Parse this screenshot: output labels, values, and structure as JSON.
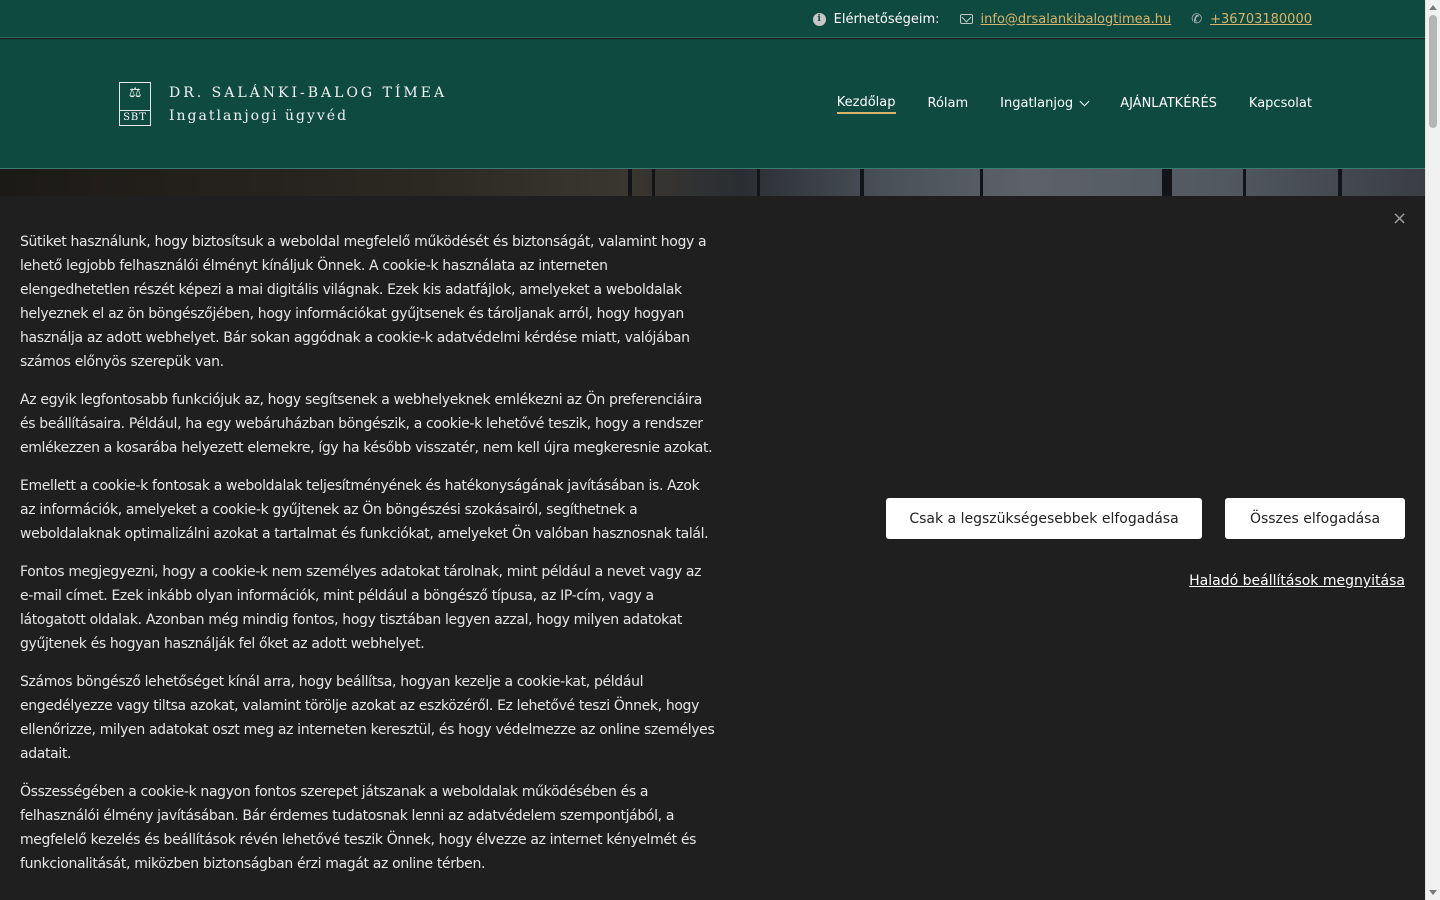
{
  "topbar": {
    "contact_label": "Elérhetőségeim:",
    "email": "info@drsalankibalogtimea.hu",
    "phone": "+36703180000",
    "icons": [
      "info-icon",
      "mail-icon",
      "phone-icon"
    ]
  },
  "header": {
    "logo": {
      "monogram": "SBT",
      "name": "DR. SALÁNKI-BALOG TÍMEA",
      "subtitle": "Ingatlanjogi ügyvéd"
    },
    "nav": [
      {
        "label": "Kezdőlap",
        "active": true
      },
      {
        "label": "Rólam",
        "active": false
      },
      {
        "label": "Ingatlanjog",
        "active": false,
        "has_dropdown": true
      },
      {
        "label": "AJÁNLATKÉRÉS",
        "active": false
      },
      {
        "label": "Kapcsolat",
        "active": false
      }
    ]
  },
  "cookie_banner": {
    "paragraphs": [
      "Sütiket használunk, hogy biztosítsuk a weboldal megfelelő működését és biztonságát, valamint hogy a lehető legjobb felhasználói élményt kínáljuk Önnek. A cookie-k használata az interneten elengedhetetlen részét képezi a mai digitális világnak. Ezek kis adatfájlok, amelyeket a weboldalak helyeznek el az ön böngészőjében, hogy információkat gyűjtsenek és tároljanak arról, hogy hogyan használja az adott webhelyet. Bár sokan aggódnak a cookie-k adatvédelmi kérdése miatt, valójában számos előnyös szerepük van.",
      "Az egyik legfontosabb funkciójuk az, hogy segítsenek a webhelyeknek emlékezni az Ön preferenciáira és beállításaira. Például, ha egy webáruházban böngészik, a cookie-k lehetővé teszik, hogy a rendszer emlékezzen a kosarába helyezett elemekre, így ha később visszatér, nem kell újra megkeresnie azokat.",
      "Emellett a cookie-k fontosak a weboldalak teljesítményének és hatékonyságának javításában is. Azok az információk, amelyeket a cookie-k gyűjtenek az Ön böngészési szokásairól, segíthetnek a weboldalaknak optimalizálni azokat a tartalmat és funkciókat, amelyeket Ön valóban hasznosnak talál.",
      "Fontos megjegyezni, hogy a cookie-k nem személyes adatokat tárolnak, mint például a nevet vagy az e-mail címet. Ezek inkább olyan információk, mint például a böngésző típusa, az IP-cím, vagy a látogatott oldalak. Azonban még mindig fontos, hogy tisztában legyen azzal, hogy milyen adatokat gyűjtenek és hogyan használják fel őket az adott webhelyet.",
      "Számos böngésző lehetőséget kínál arra, hogy beállítsa, hogyan kezelje a cookie-kat, például engedélyezze vagy tiltsa azokat, valamint törölje azokat az eszközéről. Ez lehetővé teszi Önnek, hogy ellenőrizze, milyen adatokat oszt meg az interneten keresztül, és hogy védelmezze az online személyes adatait.",
      "Összességében a cookie-k nagyon fontos szerepet játszanak a weboldalak működésében és a felhasználói élmény javításában. Bár érdemes tudatosnak lenni az adatvédelem szempontjából, a megfelelő kezelés és beállítások révén lehetővé teszik Önnek, hogy élvezze az internet kényelmét és funkcionalitását, miközben biztonságban érzi magát az online térben."
    ],
    "btn_necessary": "Csak a legszükségesebbek elfogadása",
    "btn_all": "Összes elfogadása",
    "advanced_link": "Haladó beállítások megnyitása",
    "close_symbol": "×"
  },
  "colors": {
    "header_bg": "#0e4a40",
    "accent": "#d8b36b",
    "banner_bg": "#1f1f1f"
  }
}
